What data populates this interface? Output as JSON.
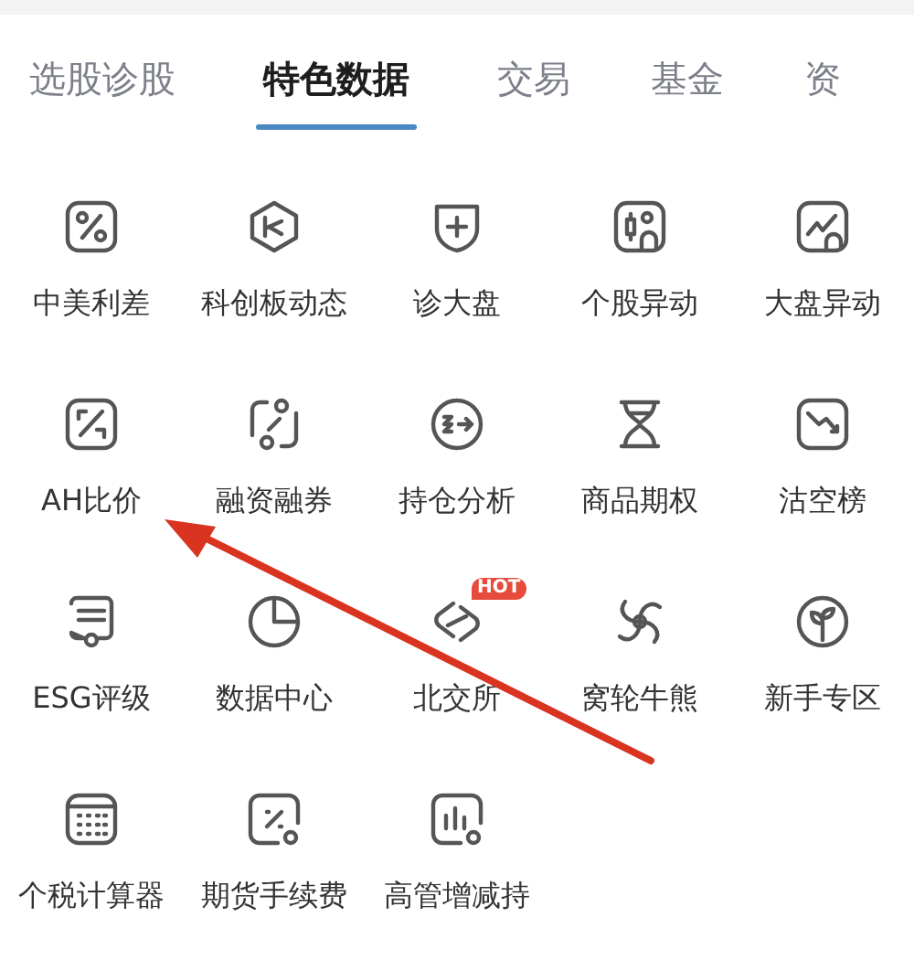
{
  "tabs": [
    {
      "label": "选股诊股",
      "selected": false
    },
    {
      "label": "特色数据",
      "selected": true
    },
    {
      "label": "交易",
      "selected": false
    },
    {
      "label": "基金",
      "selected": false
    },
    {
      "label": "资",
      "selected": false
    }
  ],
  "features": [
    {
      "label": "中美利差"
    },
    {
      "label": "科创板动态"
    },
    {
      "label": "诊大盘"
    },
    {
      "label": "个股异动"
    },
    {
      "label": "大盘异动"
    },
    {
      "label": "AH比价"
    },
    {
      "label": "融资融券"
    },
    {
      "label": "持仓分析"
    },
    {
      "label": "商品期权"
    },
    {
      "label": "沽空榜"
    },
    {
      "label": "ESG评级"
    },
    {
      "label": "数据中心"
    },
    {
      "label": "北交所",
      "badge": "HOT"
    },
    {
      "label": "窝轮牛熊"
    },
    {
      "label": "新手专区"
    },
    {
      "label": "个税计算器"
    },
    {
      "label": "期货手续费"
    },
    {
      "label": "高管增减持"
    }
  ]
}
